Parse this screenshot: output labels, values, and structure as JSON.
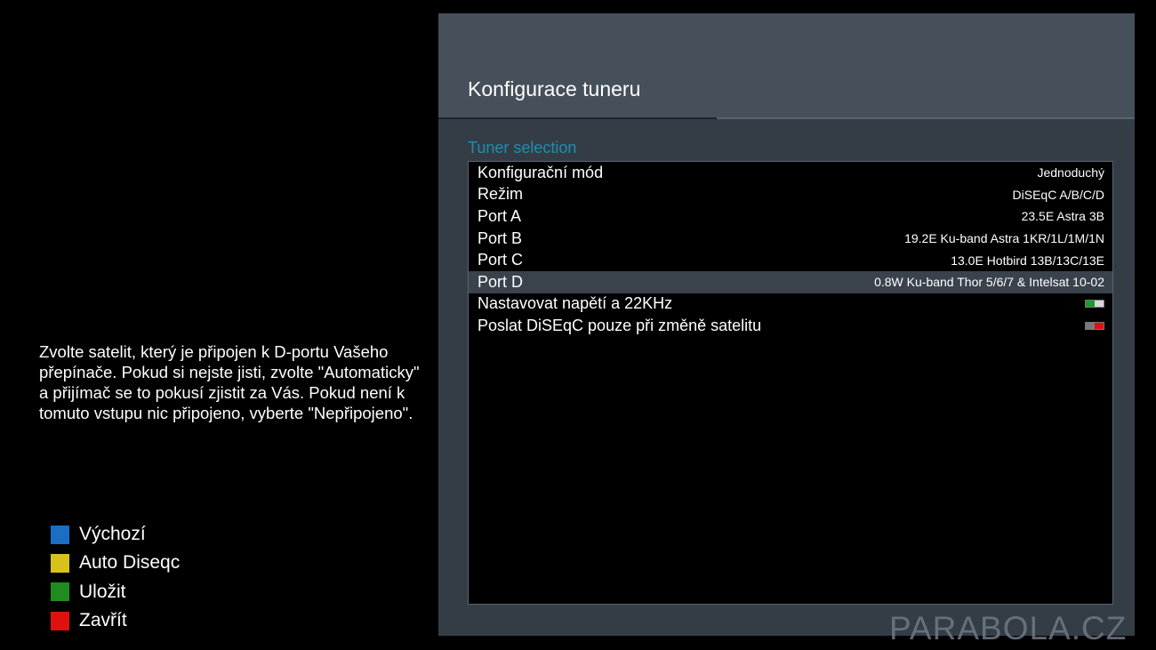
{
  "screen": {
    "title": "Konfigurace tuneru",
    "section_label": "Tuner selection"
  },
  "help_text": "Zvolte satelit, který je připojen k D-portu Vašeho přepínače. Pokud si nejste jisti, zvolte \"Automaticky\" a přijímač se to pokusí zjistit za Vás. Pokud není k tomuto vstupu nic připojeno, vyberte \"Nepřipojeno\".",
  "color_keys": [
    {
      "label": "Výchozí",
      "color": "#1a6fc4"
    },
    {
      "label": "Auto Diseqc",
      "color": "#d8c21a"
    },
    {
      "label": "Uložit",
      "color": "#1e8c1e"
    },
    {
      "label": "Zavřít",
      "color": "#e01010"
    }
  ],
  "config_rows": [
    {
      "label": "Konfigurační mód",
      "value": "Jednoduchý",
      "selected": false
    },
    {
      "label": "Režim",
      "value": "DiSEqC A/B/C/D",
      "selected": false
    },
    {
      "label": "Port A",
      "value": "23.5E Astra 3B",
      "selected": false
    },
    {
      "label": "Port B",
      "value": "19.2E Ku-band Astra 1KR/1L/1M/1N",
      "selected": false
    },
    {
      "label": "Port C",
      "value": "13.0E Hotbird 13B/13C/13E",
      "selected": false
    },
    {
      "label": "Port D",
      "value": "0.8W Ku-band Thor 5/6/7 & Intelsat 10-02",
      "selected": true
    },
    {
      "label": "Nastavovat napětí a 22KHz",
      "toggle": "on",
      "toggle_colors": [
        "#1e9a2e",
        "#d8d8d8"
      ],
      "selected": false
    },
    {
      "label": "Poslat DiSEqC pouze při změně satelitu",
      "toggle": "off",
      "toggle_colors": [
        "#7a7a7a",
        "#e01010"
      ],
      "selected": false
    }
  ],
  "watermark": "PARABOLA.CZ"
}
